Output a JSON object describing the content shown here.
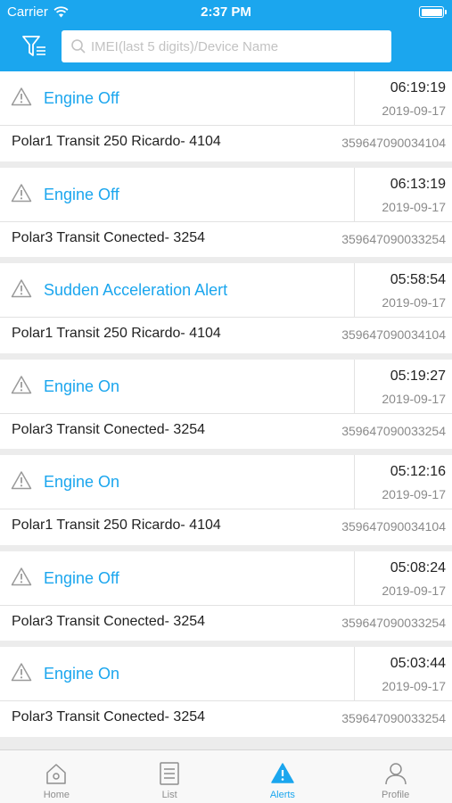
{
  "status_bar": {
    "carrier": "Carrier",
    "time": "2:37 PM"
  },
  "search": {
    "placeholder": "IMEI(last 5 digits)/Device Name"
  },
  "alerts": [
    {
      "type": "Engine Off",
      "time": "06:19:19",
      "date": "2019-09-17",
      "device": "Polar1 Transit 250 Ricardo- 4104",
      "imei": "359647090034104"
    },
    {
      "type": "Engine Off",
      "time": "06:13:19",
      "date": "2019-09-17",
      "device": "Polar3 Transit Conected- 3254",
      "imei": "359647090033254"
    },
    {
      "type": "Sudden Acceleration Alert",
      "time": "05:58:54",
      "date": "2019-09-17",
      "device": "Polar1 Transit 250 Ricardo- 4104",
      "imei": "359647090034104"
    },
    {
      "type": "Engine On",
      "time": "05:19:27",
      "date": "2019-09-17",
      "device": "Polar3 Transit Conected- 3254",
      "imei": "359647090033254"
    },
    {
      "type": "Engine On",
      "time": "05:12:16",
      "date": "2019-09-17",
      "device": "Polar1 Transit 250 Ricardo- 4104",
      "imei": "359647090034104"
    },
    {
      "type": "Engine Off",
      "time": "05:08:24",
      "date": "2019-09-17",
      "device": "Polar3 Transit Conected- 3254",
      "imei": "359647090033254"
    },
    {
      "type": "Engine On",
      "time": "05:03:44",
      "date": "2019-09-17",
      "device": "Polar3 Transit Conected- 3254",
      "imei": "359647090033254"
    }
  ],
  "tabs": [
    {
      "label": "Home",
      "icon": "home-icon",
      "active": false
    },
    {
      "label": "List",
      "icon": "list-icon",
      "active": false
    },
    {
      "label": "Alerts",
      "icon": "alert-icon",
      "active": true
    },
    {
      "label": "Profile",
      "icon": "profile-icon",
      "active": false
    }
  ],
  "colors": {
    "accent": "#1ba6ee",
    "tab_inactive": "#8e8e8e",
    "background": "#ececec"
  }
}
